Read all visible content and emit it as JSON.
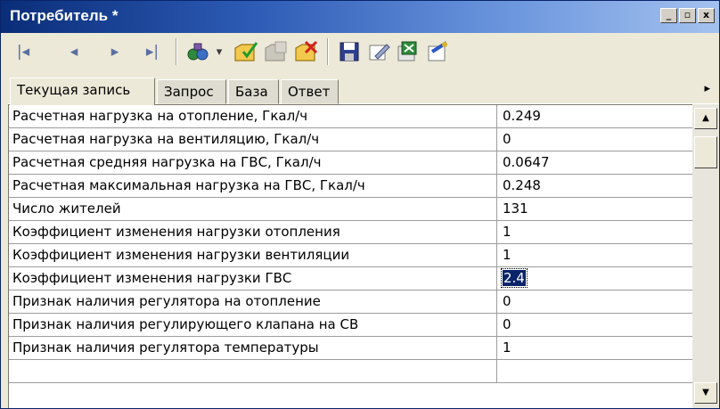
{
  "window": {
    "title": "Потребитель *",
    "controls": {
      "minimize": "_",
      "maximize": "▫",
      "close": "x"
    }
  },
  "toolbar": {
    "nav": {
      "first": "|◂",
      "prev": "◂",
      "next": "▸",
      "last": "▸|"
    },
    "dropdown_arrow": "▾"
  },
  "tabs": [
    {
      "label": "Текущая запись",
      "active": true
    },
    {
      "label": "Запрос",
      "active": false
    },
    {
      "label": "База",
      "active": false
    },
    {
      "label": "Ответ",
      "active": false
    }
  ],
  "tab_scroll_arrow": "▸",
  "grid": {
    "rows": [
      {
        "name": "Расчетная нагрузка на отопление, Гкал/ч",
        "value": "0.249"
      },
      {
        "name": "Расчетная нагрузка на вентиляцию, Гкал/ч",
        "value": "0"
      },
      {
        "name": "Расчетная средняя нагрузка на ГВС, Гкал/ч",
        "value": "0.0647"
      },
      {
        "name": "Расчетная максимальная нагрузка на ГВС, Гкал/ч",
        "value": "0.248"
      },
      {
        "name": "Число жителей",
        "value": "131"
      },
      {
        "name": "Коэффициент изменения нагрузки отопления",
        "value": "1"
      },
      {
        "name": "Коэффициент изменения нагрузки вентиляции",
        "value": "1"
      },
      {
        "name": "Коэффициент изменения нагрузки ГВС",
        "value": "2.4",
        "selected": true
      },
      {
        "name": "Признак наличия регулятора на отопление",
        "value": "0"
      },
      {
        "name": "Признак наличия регулирующего клапана на СВ",
        "value": "0"
      },
      {
        "name": "Признак наличия регулятора температуры",
        "value": "1"
      }
    ]
  },
  "scrollbar": {
    "up": "▲",
    "down": "▼"
  },
  "colors": {
    "title_start": "#0a2d78",
    "title_end": "#a4c2ef",
    "selection": "#0a246a",
    "face": "#ece9d8"
  },
  "icons": [
    "nav-first-icon",
    "nav-prev-icon",
    "nav-next-icon",
    "nav-last-icon",
    "filter-icon",
    "add-record-icon",
    "copy-record-icon",
    "delete-record-icon",
    "save-icon",
    "edit-icon",
    "export-icon",
    "report-icon"
  ]
}
